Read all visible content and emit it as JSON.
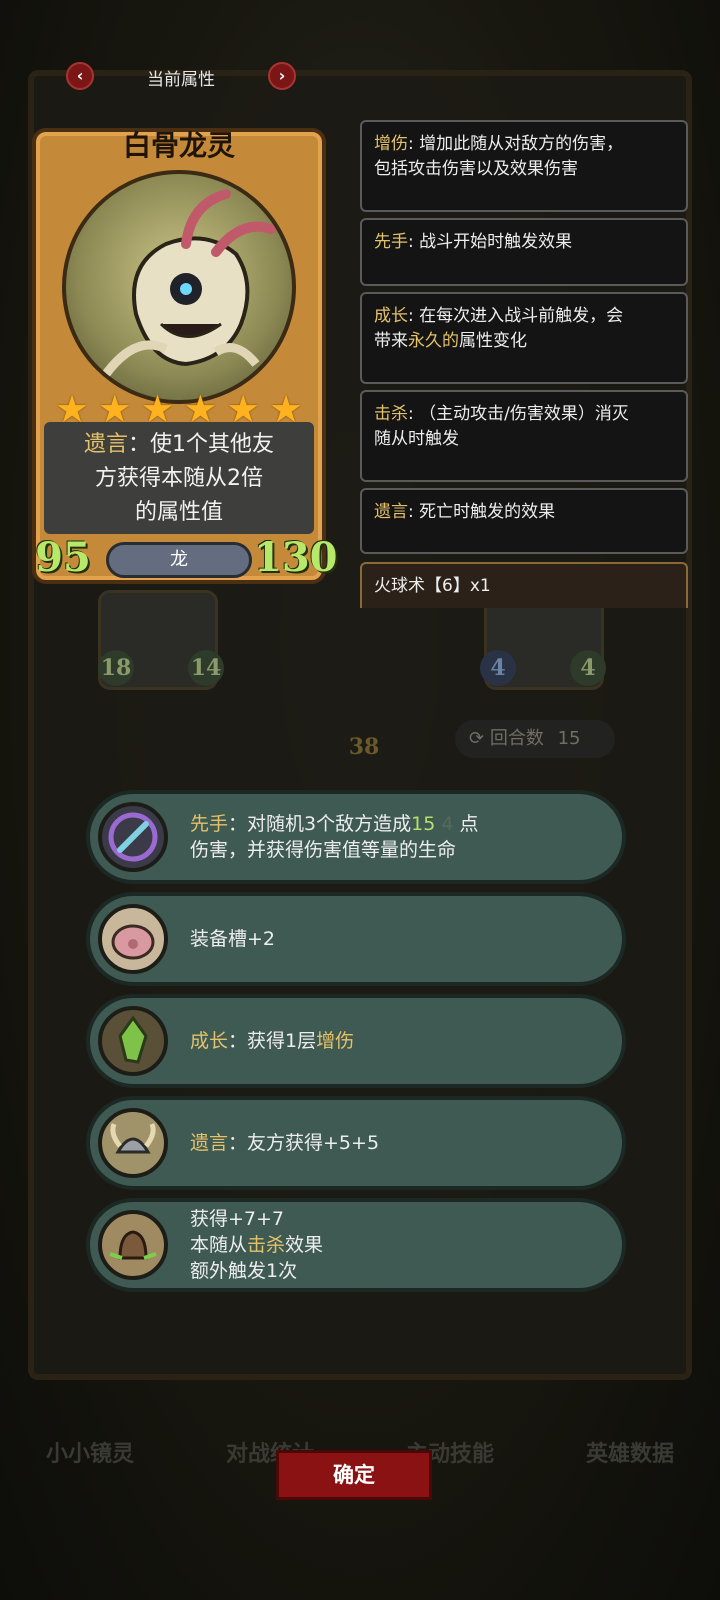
{
  "header": {
    "title": "当前属性",
    "prev_icon": "chevron-left-icon",
    "next_icon": "chevron-right-icon"
  },
  "card": {
    "name": "白骨龙灵",
    "star_count": 6,
    "star_glyph": "★",
    "description": {
      "line1_keyword": "遗言",
      "line1_rest": "：使1个其他友",
      "line2": "方获得本随从2倍",
      "line3": "的属性值"
    },
    "attack": "95",
    "health": "130",
    "tribe": "龙"
  },
  "glossary": [
    {
      "keyword": "增伤",
      "text": ": 增加此随从对敌方的伤害，",
      "line2": "包括攻击伤害以及效果伤害"
    },
    {
      "keyword": "先手",
      "text": ": 战斗开始时触发效果"
    },
    {
      "keyword": "成长",
      "text": ": 在每次进入战斗前触发，会",
      "line2_pre": "带来",
      "line2_kw": "永久的",
      "line2_post": "属性变化"
    },
    {
      "keyword": "击杀",
      "text": ": （主动攻击/伤害效果）消灭",
      "line2": "随从时触发"
    },
    {
      "keyword": "遗言",
      "text": ": 死亡时触发的效果"
    },
    {
      "text": "火球术【6】x1"
    }
  ],
  "board": {
    "left_attack": "18",
    "left_health": "14",
    "right_attack": "4",
    "right_health": "4",
    "arrow_value": "38",
    "round_label": "回合数",
    "round_value": "15"
  },
  "effects": [
    {
      "icon": "cursed-dagger-icon",
      "keyword": "先手",
      "pre": "：对随机3个敌方造成",
      "value": "15",
      "value2": "4",
      "post": " 点",
      "line2": "伤害，并获得伤害值等量的生命"
    },
    {
      "icon": "pig-armor-icon",
      "line1": "装备槽+2"
    },
    {
      "icon": "green-crystal-icon",
      "keyword": "成长",
      "pre": "：获得1层",
      "kw2": "增伤"
    },
    {
      "icon": "horned-helm-icon",
      "keyword": "遗言",
      "pre": "：友方获得+5+5"
    },
    {
      "icon": "bell-icon",
      "line1": "获得+7+7",
      "line2_pre": "本随从",
      "line2_kw": "击杀",
      "line2_post": "效果",
      "line3": "额外触发1次"
    }
  ],
  "bottom_tabs": [
    "小小镜灵",
    "对战统计",
    "主动技能",
    "英雄数据"
  ],
  "confirm_label": "确定",
  "colors": {
    "keyword_gold": "#e4c26a",
    "keyword_green": "#b6e06a",
    "effect_bg": "#3f5a52",
    "confirm_bg": "#8a1212"
  }
}
